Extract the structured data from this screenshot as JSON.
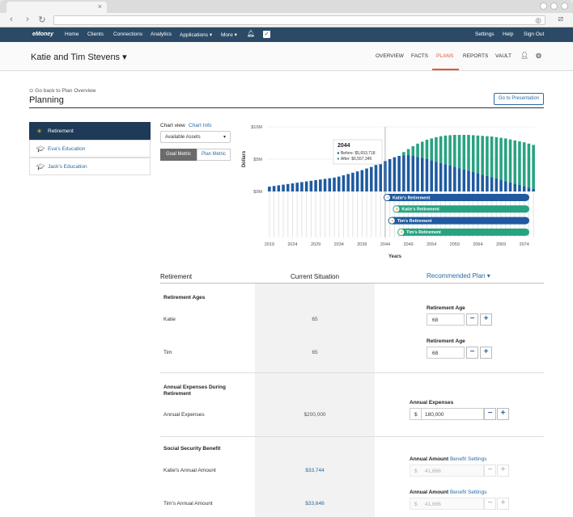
{
  "nav": {
    "logo": "eMoney",
    "items": [
      "Home",
      "Clients",
      "Connections",
      "Analytics",
      "Applications ▾",
      "More ▾"
    ],
    "right": [
      "Settings",
      "Help",
      "Sign Out"
    ]
  },
  "client": {
    "name": "Katie and Tim Stevens ▾"
  },
  "subnav": [
    "OVERVIEW",
    "FACTS",
    "PLANS",
    "REPORTS",
    "VAULT"
  ],
  "page": {
    "back": "Go back to Plan Overview",
    "title": "Planning",
    "presentation_btn": "Go to Presentation"
  },
  "goals": [
    "Retirement",
    "Eva's Education",
    "Jack's Education"
  ],
  "chart_view": {
    "label": "Chart view",
    "info": "Chart Info",
    "select": "Available Assets",
    "toggle_on": "Goal Metric",
    "toggle_off": "Plan Metric"
  },
  "chart_data": {
    "type": "bar",
    "ylabel": "Dollars",
    "xlabel": "Years",
    "y_ticks": [
      "$10M",
      "$5M",
      "$0M"
    ],
    "ylim": [
      0,
      10000000
    ],
    "x_ticks": [
      "2019",
      "2024",
      "2029",
      "2034",
      "2039",
      "2044",
      "2049",
      "2054",
      "2059",
      "2064",
      "2069",
      "2074"
    ],
    "start_year": 2019,
    "end_year": 2076,
    "series": [
      {
        "name": "Before",
        "color": "#1f5aa0",
        "values": [
          0.75,
          0.85,
          0.95,
          1.05,
          1.15,
          1.25,
          1.35,
          1.45,
          1.55,
          1.65,
          1.75,
          1.85,
          1.95,
          2.05,
          2.15,
          2.3,
          2.5,
          2.7,
          2.9,
          3.1,
          3.3,
          3.55,
          3.8,
          4.1,
          4.4,
          4.7,
          5.0,
          5.3,
          5.5,
          5.6,
          5.65,
          5.5,
          5.35,
          5.2,
          5.0,
          4.8,
          4.6,
          4.4,
          4.2,
          4.0,
          3.8,
          3.6,
          3.4,
          3.2,
          3.0,
          2.8,
          2.6,
          2.4,
          2.2,
          2.0,
          1.8,
          1.6,
          1.4,
          1.2,
          1.0,
          0.8,
          0.6,
          0.4
        ]
      },
      {
        "name": "After",
        "color": "#27a382",
        "values": [
          0.75,
          0.85,
          0.95,
          1.05,
          1.15,
          1.25,
          1.35,
          1.45,
          1.55,
          1.65,
          1.75,
          1.85,
          1.95,
          2.05,
          2.15,
          2.3,
          2.5,
          2.7,
          2.9,
          3.1,
          3.3,
          3.55,
          3.8,
          4.1,
          4.4,
          4.7,
          5.0,
          5.3,
          5.5,
          6.1,
          6.56,
          7.0,
          7.4,
          7.7,
          8.0,
          8.2,
          8.4,
          8.55,
          8.65,
          8.7,
          8.75,
          8.75,
          8.75,
          8.75,
          8.7,
          8.65,
          8.6,
          8.55,
          8.5,
          8.4,
          8.3,
          8.2,
          8.05,
          7.9,
          7.75,
          7.6,
          7.4,
          7.2
        ]
      }
    ],
    "tooltip": {
      "year": "2044",
      "before": "Before: $5,653,718",
      "after": "After:   $6,557,345"
    },
    "timeline": [
      {
        "label": "Katie's Retirement",
        "color": "#1f5aa0",
        "start": 2044,
        "end": 2076
      },
      {
        "label": "Katie's Retirement",
        "color": "#27a382",
        "start": 2046,
        "end": 2076
      },
      {
        "label": "Tim's Retirement",
        "color": "#1f5aa0",
        "start": 2045,
        "end": 2076
      },
      {
        "label": "Tim's Retirement",
        "color": "#27a382",
        "start": 2047,
        "end": 2076
      }
    ]
  },
  "table": {
    "headers": {
      "c1": "Retirement",
      "c2": "Current Situation",
      "c3": "Recommended Plan ▾"
    },
    "sec1": "Retirement Ages",
    "katie": "Katie",
    "tim": "Tim",
    "katie_current": "65",
    "tim_current": "65",
    "ret_age_label": "Retirement Age",
    "katie_rec": "68",
    "tim_rec": "68",
    "sec2": "Annual Expenses During Retirement",
    "annual_exp": "Annual Expenses",
    "annual_exp_current": "$200,000",
    "annual_exp_label": "Annual Expenses",
    "currency": "$",
    "annual_exp_rec": "180,000",
    "sec3": "Social Security Benefit",
    "katie_amt": "Katie's Annual Amount",
    "tim_amt": "Tim's Annual Amount",
    "katie_amt_current": "$33,744",
    "tim_amt_current": "$33,646",
    "annual_amt_label": "Annual Amount",
    "benefit_settings": "Benefit Settings",
    "disabled_val": "41,666",
    "minus": "−",
    "plus": "+"
  }
}
